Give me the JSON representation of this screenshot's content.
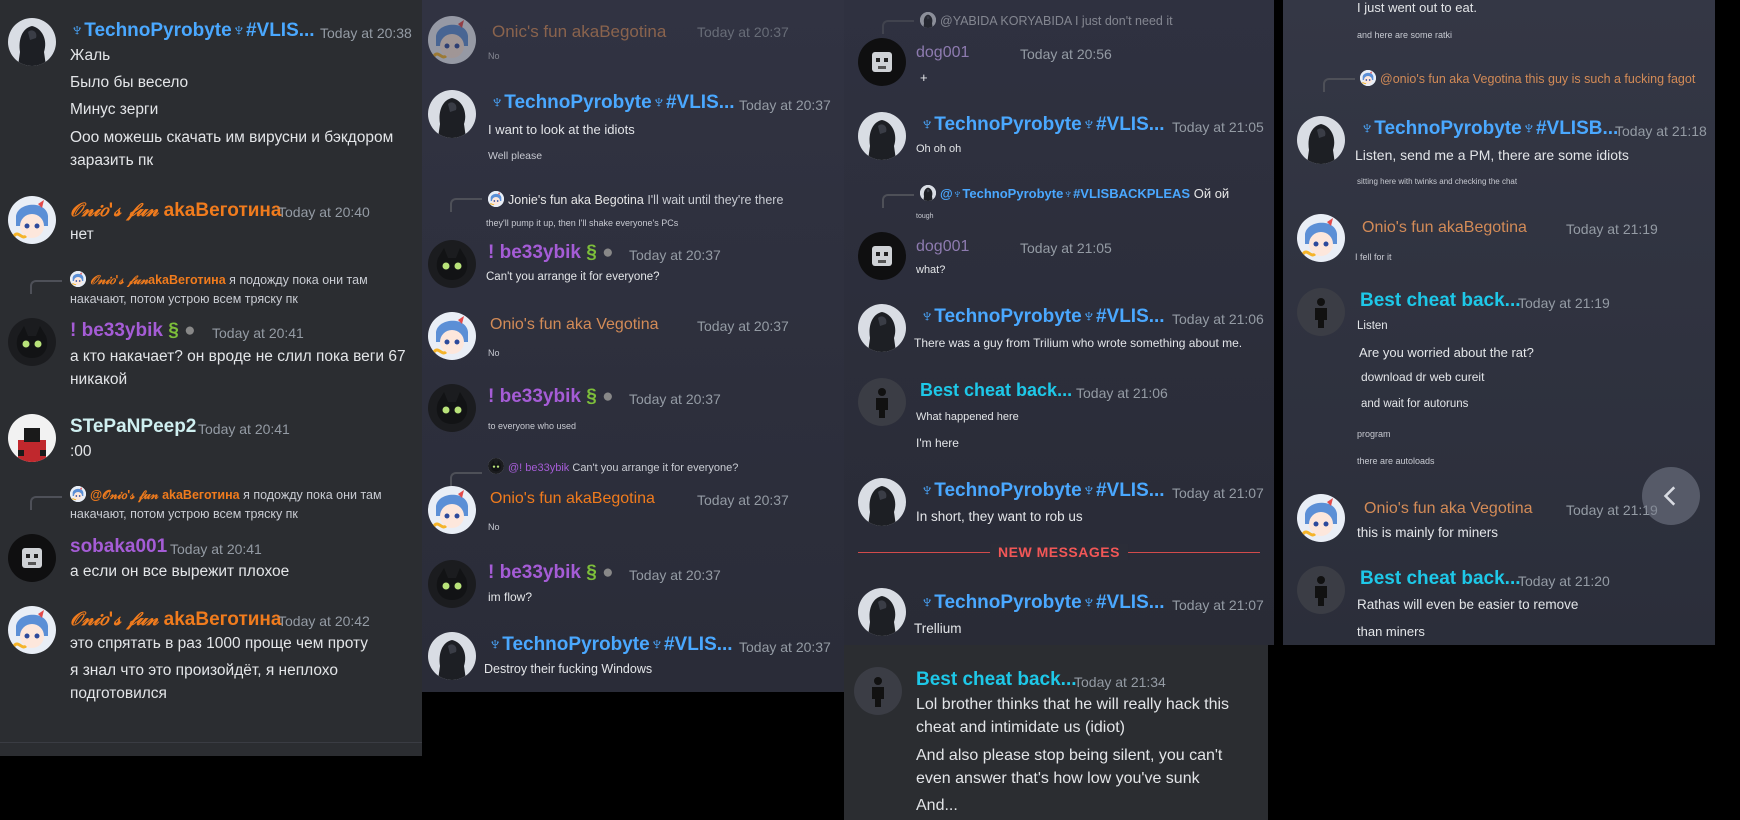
{
  "colors": {
    "blue": "#4aa8ff",
    "orange": "#f07b1d",
    "purple": "#a55cd6",
    "cyan": "#1ec8e8",
    "new_messages": "#f25757"
  },
  "p1": {
    "m1": {
      "name": "♆TechnoPyrobyte♆#VLIS...",
      "time": "Today at 20:38",
      "lines": [
        "Жаль",
        "Было бы весело",
        "Минус зерги",
        "Ооо можешь скачать им вирусни и бэкдором заразить пк"
      ]
    },
    "m2": {
      "name_fancy": "𝒪𝓃𝒾𝑜'𝓈 𝒻𝓊𝓃",
      "name_plain": "akaВеготина",
      "time": "Today at 20:40",
      "lines": [
        "нет"
      ]
    },
    "m3": {
      "reply_name_fancy": "𝒪𝓃𝒾𝑜'𝓈 𝒻𝓊𝓃",
      "reply_name_plain": "akaВеготина",
      "reply_text": "я подожду пока они там накачают, потом устрою всем тряску пк",
      "name": "! be33ybik",
      "time": "Today at 20:41",
      "lines": [
        "а кто накачает? он вроде не слил пока веги 67 никакой"
      ]
    },
    "m4": {
      "name": "STePaNPeep2",
      "time": "Today at 20:41",
      "lines": [
        ":00"
      ]
    },
    "m5": {
      "reply_name": "@𝒪𝓃𝒾𝑜'𝓈 𝒻𝓊𝓃 akaВеготина",
      "reply_text": "я подожду пока они там накачают, потом устрою всем тряску пк",
      "name": "sobaka001",
      "time": "Today at 20:41",
      "lines": [
        "а если он все вырежит плохое"
      ]
    },
    "m6": {
      "name_fancy": "𝒪𝓃𝒾𝑜'𝓈 𝒻𝓊𝓃",
      "name_plain": "akaВеготина",
      "time": "Today at 20:42",
      "lines": [
        "это спрятать в раз 1000 проще чем проту",
        "я знал что это произойдёт, я неплохо подготовился"
      ]
    }
  },
  "p2": {
    "m1": {
      "name": "Onic's fun akaBegotina",
      "time": "Today at 20:37",
      "line": "No"
    },
    "m2": {
      "name": "♆TechnoPyrobyte♆#VLIS...",
      "time": "Today at 20:37",
      "line1": "I want to look at the idiots",
      "line2": "Well please"
    },
    "m3": {
      "reply_name": "Jonie's fun aka Begotina",
      "reply_text": "I'll wait until they're there",
      "reply_sub": "they'll pump it up, then I'll shake everyone's PCs",
      "name": "! be33ybik",
      "time": "Today at 20:37",
      "line": "Can't you arrange it for everyone?"
    },
    "m4": {
      "name": "Onio's fun aka Vegotina",
      "time": "Today at 20:37",
      "line": "No"
    },
    "m5": {
      "name": "! be33ybik",
      "time": "Today at 20:37",
      "line": "to everyone who used"
    },
    "m6": {
      "reply_name": "@! be33ybik",
      "reply_text": "Can't you arrange it for everyone?",
      "name": "Onio's fun akaBegotina",
      "time": "Today at 20:37",
      "line": "No"
    },
    "m7": {
      "name": "! be33ybik",
      "time": "Today at 20:37",
      "line": "im flow?"
    },
    "m8": {
      "name": "♆TechnoPyrobyte♆#VLIS...",
      "time": "Today at 20:37",
      "line": "Destroy their fucking Windows"
    }
  },
  "p3": {
    "m0": {
      "reply_name": "@YABIDA KORYABIDA",
      "reply_text": "I just don't need it",
      "name": "dog001",
      "time": "Today at 20:56",
      "line": "+"
    },
    "m1": {
      "name": "♆TechnoPyrobyte♆#VLIS...",
      "time": "Today at 21:05",
      "line": "Oh oh oh"
    },
    "m2": {
      "reply_name": "@♆TechnoPyrobyte♆#VLISBACKPLEAS",
      "reply_text": "Ой ой",
      "reply_sub": "tough",
      "name": "dog001",
      "time": "Today at 21:05",
      "line": "what?"
    },
    "m3": {
      "name": "♆TechnoPyrobyte♆#VLIS...",
      "time": "Today at 21:06",
      "line": "There was a guy from Trilium who wrote something about me."
    },
    "m4": {
      "name": "Best cheat back...",
      "time": "Today at 21:06",
      "line1": "What happened here",
      "line2": "I'm here"
    },
    "m5": {
      "name": "♆TechnoPyrobyte♆#VLIS...",
      "time": "Today at 21:07",
      "line": "In short, they want to rob us"
    },
    "new_messages": "NEW MESSAGES",
    "m6": {
      "name": "♆TechnoPyrobyte♆#VLIS...",
      "time": "Today at 21:07",
      "line": "Trellium"
    }
  },
  "p4": {
    "m1": {
      "name": "Best cheat back...",
      "time": "Today at 21:34",
      "lines": [
        "Lol brother thinks that he will really hack this cheat and intimidate us (idiot)",
        "And also please stop being silent, you can't even answer that's how low you've sunk",
        "And..."
      ]
    }
  },
  "p5": {
    "m0": {
      "line1": "I just went out to eat.",
      "line2": "and here are some ratki"
    },
    "m1": {
      "reply_name": "@onio's fun aka Vegotina",
      "reply_text": "this guy is such a fucking fagot",
      "name": "♆TechnoPyrobyte♆#VLISB...",
      "time": "Today at 21:18",
      "line1": "Listen, send me a PM, there are some idiots",
      "line2": "sitting here with twinks and checking the chat"
    },
    "m2": {
      "name": "Onio's fun akaBegotina",
      "time": "Today at 21:19",
      "line": "I fell for it"
    },
    "m3": {
      "name": "Best cheat back...",
      "time": "Today at 21:19",
      "lines": [
        "Listen",
        "Are you worried about the rat?",
        "download dr web cureit",
        "and wait for autoruns",
        "program",
        "there are autoloads"
      ]
    },
    "m4": {
      "name": "Onio's fun aka Vegotina",
      "time": "Today at 21:19",
      "line": "this is mainly for miners"
    },
    "m5": {
      "name": "Best cheat back...",
      "time": "Today at 21:20",
      "line1": "Rathas will even be easier to remove",
      "line2": "than miners"
    }
  }
}
